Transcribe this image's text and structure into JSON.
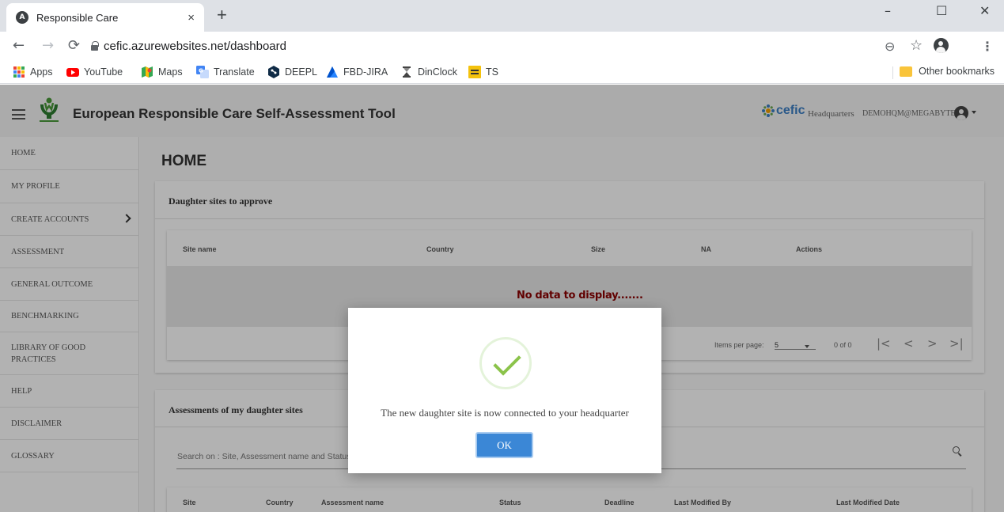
{
  "browser": {
    "tab": {
      "title": "Responsible Care",
      "close": "×",
      "favicon_letter": "A"
    },
    "new_tab": "+",
    "window_controls": {
      "minimize": "–",
      "maximize": "☐",
      "close": "✕"
    },
    "nav": {
      "back": "←",
      "forward": "→",
      "reload": "⟳"
    },
    "url": "cefic.azurewebsites.net/dashboard",
    "address_icons": {
      "zoom": "⊖",
      "star": "☆",
      "menu": "⋮"
    },
    "bookmarks": [
      {
        "label": "Apps",
        "icon": "apps-grid-icon",
        "color": "#e8453c"
      },
      {
        "label": "YouTube",
        "icon": "youtube-icon",
        "color": "#ff0000"
      },
      {
        "label": "Maps",
        "icon": "maps-icon",
        "color": "#34a853"
      },
      {
        "label": "Translate",
        "icon": "translate-icon",
        "color": "#4285f4"
      },
      {
        "label": "DEEPL",
        "icon": "deepl-icon",
        "color": "#0f2b46"
      },
      {
        "label": "FBD-JIRA",
        "icon": "jira-icon",
        "color": "#2684ff"
      },
      {
        "label": "DinClock",
        "icon": "dinclock-icon",
        "color": "#444444"
      },
      {
        "label": "TS",
        "icon": "ts-icon",
        "color": "#f4c20d"
      }
    ],
    "other_bookmarks": "Other bookmarks"
  },
  "header": {
    "title": "European Responsible Care Self-Assessment Tool",
    "brand": "cefic",
    "role": "Headquarters",
    "user": "DEMOHQM@MEGABYTE.BE"
  },
  "sidebar": {
    "items": [
      {
        "label": "HOME"
      },
      {
        "label": "MY PROFILE"
      },
      {
        "label": "CREATE ACCOUNTS"
      },
      {
        "label": "ASSESSMENT"
      },
      {
        "label": "GENERAL OUTCOME"
      },
      {
        "label": "BENCHMARKING"
      },
      {
        "label": "LIBRARY OF GOOD PRACTICES"
      },
      {
        "label": "HELP"
      },
      {
        "label": "DISCLAIMER"
      },
      {
        "label": "GLOSSARY"
      }
    ]
  },
  "main": {
    "title": "HOME",
    "approve_card": {
      "title": "Daughter sites to approve",
      "columns": [
        "Site name",
        "Country",
        "Size",
        "NA",
        "Actions"
      ],
      "no_data": "No data to display.......",
      "items_per_page_label": "Items per page:",
      "items_per_page": "5",
      "range": "0 of 0",
      "pager": {
        "first": "|<",
        "prev": "<",
        "next": ">",
        "last": ">|"
      }
    },
    "assessments_card": {
      "title": "Assessments of my daughter sites",
      "search_placeholder": "Search on : Site, Assessment name and Status",
      "columns": [
        "Site",
        "Country",
        "Assessment name",
        "Status",
        "Deadline",
        "Last Modified By",
        "Last Modified Date"
      ]
    }
  },
  "dialog": {
    "message": "The new daughter site is now connected to your headquarter",
    "ok": "OK"
  }
}
